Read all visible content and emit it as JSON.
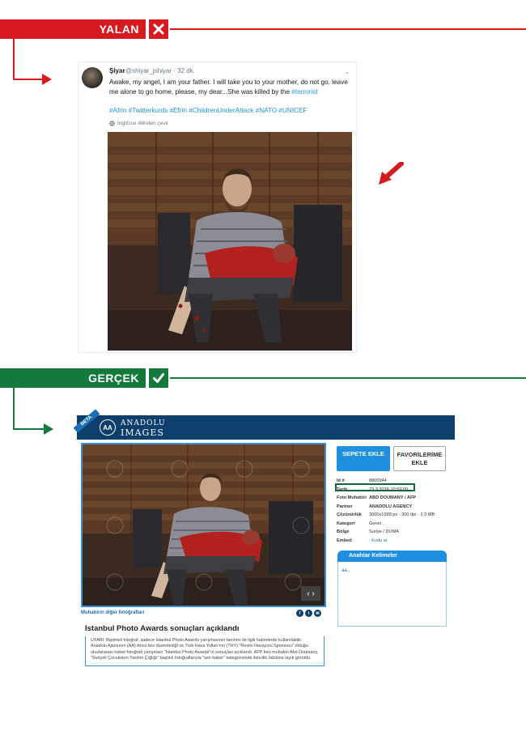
{
  "banners": {
    "false_label": "YALAN",
    "true_label": "GERÇEK",
    "false_color": "#d71920",
    "true_color": "#127a3a"
  },
  "tweet": {
    "name": "Şiyar",
    "handle_time": "@shiyar_jshiyar · 32 dk.",
    "text": "Awake, my angel, I am your father. I will take you to your mother, do not go, leave me alone to go home, please, my dear...She was killed by the",
    "text_link": "#terrorist",
    "hashtags": "#Afrin #Twitterkurds #Efrin #ChildrenUnderAttack #NATO  #UNICEF",
    "translate": "İngilizce dilinden çevir",
    "link_color": "#1b95e0"
  },
  "anadolu": {
    "beta": "BETA",
    "logo_line1": "ANADOLU",
    "logo_line2": "IMAGES",
    "logo_mark": "AA",
    "cart_button": "SEPETE EKLE",
    "fav_button": "FAVORİLERİME EKLE",
    "meta": [
      {
        "key": "Id #",
        "value": "8800944"
      },
      {
        "key": "Tarih",
        "value": "23.3.2016 10:59:00"
      },
      {
        "key": "Foto Muhabiri",
        "value": "ABD DOUMANY / AFP"
      },
      {
        "key": "Partner",
        "value": "ANADOLU AGENCY"
      },
      {
        "key": "Çözünürlük",
        "value": "3000x1999 px - 300 dpi - 2.9 MB"
      },
      {
        "key": "Kategori",
        "value": "Genel ,"
      },
      {
        "key": "Bölge",
        "value": "Suriye / DUMA"
      },
      {
        "key": "Embed",
        "value": "Kodu al"
      }
    ],
    "keywords_title": "Anahtar Kelimeler",
    "keywords": "aa ,",
    "more_photos": "Muhabirin diğer fotoğrafları",
    "social": [
      "f",
      "t",
      "✉"
    ],
    "article_title": "Istanbul Photo Awards sonuçları açıklandı",
    "article_desc": "UYARI: Bişiimeli fotoğraf, sadece İstanbul Photo Awards yarışmasının tanıtımı ile ilgili haberlerde kullanılabilir. Anadolu Ajansının (AA) ikinci kez düzenlediği ve Türk Hava Yolları'nın (THY) \"Resmi Havayolu Sponsoru\" olduğu uluslararası haber fotoğrafı yarışması \"İstanbul Photo Awards\"ın sonuçları açıklandı. AFP foto muhabiri Abd Doumany, \"Suriyeli Çocukların Yardım Çığlığı\" başlıklı fotoğraflarıyla \"seri haber\" kategorisinde ikincilik ödülüne layık görüldü.",
    "header_color": "#0c3f6b",
    "accent_color": "#1f8fe0",
    "highlight_color": "#0e6b34"
  }
}
